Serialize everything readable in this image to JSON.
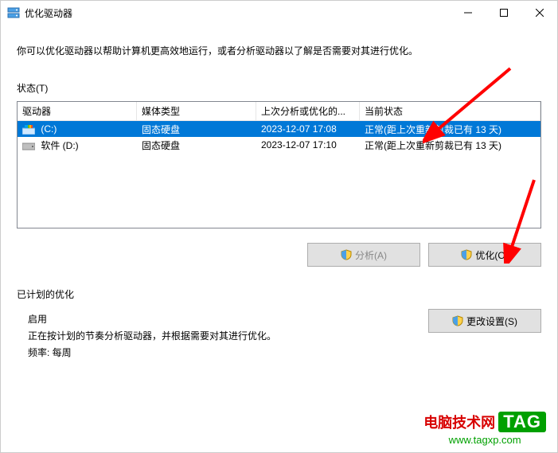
{
  "window": {
    "title": "优化驱动器"
  },
  "description": "你可以优化驱动器以帮助计算机更高效地运行，或者分析驱动器以了解是否需要对其进行优化。",
  "status_label": "状态(T)",
  "columns": {
    "drive": "驱动器",
    "media": "媒体类型",
    "last": "上次分析或优化的...",
    "status": "当前状态"
  },
  "rows": [
    {
      "drive": "(C:)",
      "media": "固态硬盘",
      "last": "2023-12-07 17:08",
      "status": "正常(距上次重新剪裁已有 13 天)",
      "selected": true,
      "icon": "os-drive-icon"
    },
    {
      "drive": "软件 (D:)",
      "media": "固态硬盘",
      "last": "2023-12-07 17:10",
      "status": "正常(距上次重新剪裁已有 13 天)",
      "selected": false,
      "icon": "drive-icon"
    }
  ],
  "buttons": {
    "analyze": "分析(A)",
    "optimize": "优化(O)",
    "change_settings": "更改设置(S)"
  },
  "schedule": {
    "section_label": "已计划的优化",
    "enabled_label": "启用",
    "desc": "正在按计划的节奏分析驱动器，并根据需要对其进行优化。",
    "freq_label": "频率: 每周"
  },
  "watermark": {
    "cn": "电脑技术网",
    "tag": "TAG",
    "url": "www.tagxp.com"
  }
}
